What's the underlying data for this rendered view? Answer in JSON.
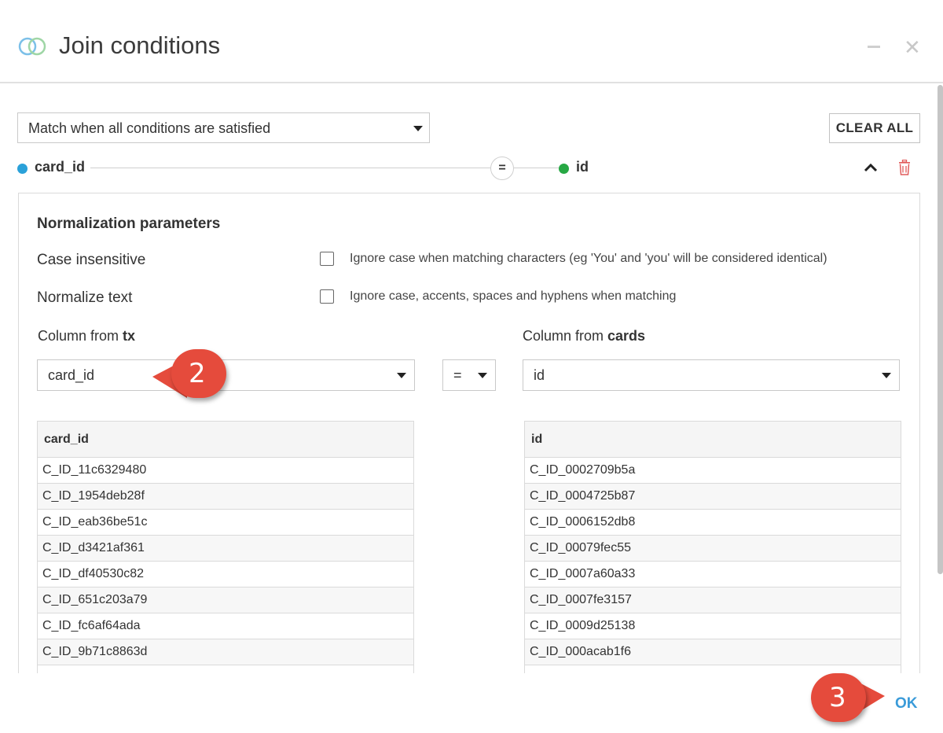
{
  "dialog": {
    "title": "Join conditions",
    "minimize_icon": "minus-icon",
    "close_icon": "close-icon",
    "header_icon": "join-venn-icon"
  },
  "match_mode": {
    "selected": "Match when all conditions are satisfied",
    "clear_all_label": "CLEAR ALL"
  },
  "condition": {
    "left_column": "card_id",
    "left_dot_color": "#2aa1d9",
    "operator": "=",
    "right_column": "id",
    "right_dot_color": "#27a844",
    "collapse_icon": "chevron-up-icon",
    "delete_icon": "trash-icon",
    "delete_color": "#e15b5b"
  },
  "normalization": {
    "title": "Normalization parameters",
    "options": [
      {
        "label": "Case insensitive",
        "description": "Ignore case when matching characters (eg 'You' and 'you' will be considered identical)",
        "checked": false
      },
      {
        "label": "Normalize text",
        "description": "Ignore case, accents, spaces and hyphens when matching",
        "checked": false
      }
    ]
  },
  "left_dataset": {
    "prefix": "Column from ",
    "name": "tx",
    "selected_column": "card_id",
    "table_header": "card_id",
    "rows": [
      "C_ID_11c6329480",
      "C_ID_1954deb28f",
      "C_ID_eab36be51c",
      "C_ID_d3421af361",
      "C_ID_df40530c82",
      "C_ID_651c203a79",
      "C_ID_fc6af64ada",
      "C_ID_9b71c8863d"
    ]
  },
  "operator_select": {
    "selected": "="
  },
  "right_dataset": {
    "prefix": "Column from ",
    "name": "cards",
    "selected_column": "id",
    "table_header": "id",
    "rows": [
      "C_ID_0002709b5a",
      "C_ID_0004725b87",
      "C_ID_0006152db8",
      "C_ID_00079fec55",
      "C_ID_0007a60a33",
      "C_ID_0007fe3157",
      "C_ID_0009d25138",
      "C_ID_000acab1f6"
    ]
  },
  "callouts": {
    "step2": "2",
    "step3": "3",
    "color": "#e54b3c"
  },
  "footer": {
    "ok_label": "OK",
    "ok_color": "#3a9bd9"
  }
}
